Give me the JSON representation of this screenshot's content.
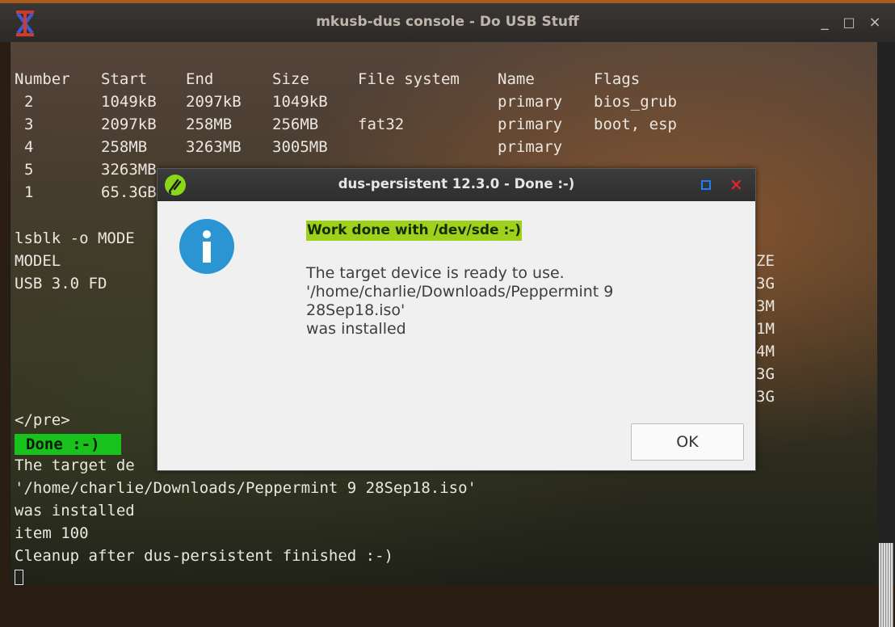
{
  "window": {
    "title": "mkusb-dus console - Do USB Stuff",
    "minimize_glyph": "_",
    "maximize_glyph": "□",
    "close_glyph": "×"
  },
  "terminal": {
    "table_header": [
      "Number",
      "Start",
      "End",
      "Size",
      "File system",
      "Name",
      "Flags"
    ],
    "partitions": [
      {
        "number": "2",
        "start": "1049kB",
        "end": "2097kB",
        "size": "1049kB",
        "fs": "",
        "name": "primary",
        "flags": "bios_grub"
      },
      {
        "number": "3",
        "start": "2097kB",
        "end": "258MB",
        "size": "256MB",
        "fs": "fat32",
        "name": "primary",
        "flags": "boot, esp"
      },
      {
        "number": "4",
        "start": "258MB",
        "end": "3263MB",
        "size": "3005MB",
        "fs": "",
        "name": "primary",
        "flags": ""
      },
      {
        "number": "5",
        "start": "3263MB",
        "end": "",
        "size": "",
        "fs": "",
        "name": "",
        "flags": ""
      },
      {
        "number": "1",
        "start": "65.3GB",
        "end": "",
        "size": "",
        "fs": "",
        "name": "",
        "flags": ""
      }
    ],
    "lsblk_cmd": "lsblk -o MODE",
    "lsblk_header": "MODEL",
    "lsblk_row": "USB 3.0 FD",
    "right_fragments": [
      "ZE",
      "3G",
      "3M",
      "1M",
      "4M",
      "3G",
      "3G"
    ],
    "pre_tag": "</pre>",
    "done_badge": "Done :-)",
    "target_line": "The target de",
    "iso_line": "'/home/charlie/Downloads/Peppermint 9 28Sep18.iso'",
    "installed_line": "was installed",
    "item_line": "item 100",
    "cleanup_line": "Cleanup after dus-persistent finished :-)"
  },
  "dialog": {
    "title": "dus-persistent 12.3.0 - Done :-)",
    "headline": "Work done with /dev/sde :-)",
    "message_lines": [
      "The target device is ready to use.",
      "'/home/charlie/Downloads/Peppermint 9",
      "28Sep18.iso'",
      "was installed"
    ],
    "ok_label": "OK",
    "close_glyph": "×",
    "icon": "info-icon"
  }
}
